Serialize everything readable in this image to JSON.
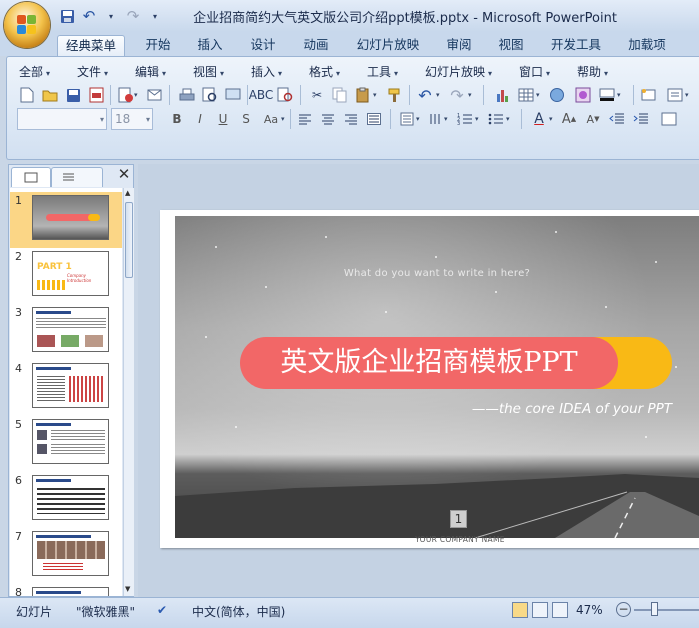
{
  "window": {
    "title": "企业招商简约大气英文版公司介绍ppt模板.pptx - Microsoft PowerPoint"
  },
  "quick_access": {
    "save_icon": "save-icon",
    "undo_icon": "undo-icon",
    "redo_icon": "redo-icon",
    "customize_icon": "chevron-down-icon"
  },
  "tabs": [
    {
      "label": "经典菜单",
      "active": true
    },
    {
      "label": "开始"
    },
    {
      "label": "插入"
    },
    {
      "label": "设计"
    },
    {
      "label": "动画"
    },
    {
      "label": "幻灯片放映"
    },
    {
      "label": "审阅"
    },
    {
      "label": "视图"
    },
    {
      "label": "开发工具"
    },
    {
      "label": "加载项"
    }
  ],
  "menu": [
    {
      "label": "全部"
    },
    {
      "label": "文件"
    },
    {
      "label": "编辑"
    },
    {
      "label": "视图"
    },
    {
      "label": "插入"
    },
    {
      "label": "格式"
    },
    {
      "label": "工具"
    },
    {
      "label": "幻灯片放映"
    },
    {
      "label": "窗口"
    },
    {
      "label": "帮助"
    }
  ],
  "format_toolbar": {
    "font_name": "",
    "font_size": "18"
  },
  "slides": [
    {
      "number": "1"
    },
    {
      "number": "2"
    },
    {
      "number": "3"
    },
    {
      "number": "4"
    },
    {
      "number": "5"
    },
    {
      "number": "6"
    },
    {
      "number": "7"
    },
    {
      "number": "8"
    }
  ],
  "thumbnail_texts": {
    "slide2_title": "PART 1",
    "slide2_subtitle": "Company Introduction"
  },
  "current_slide": {
    "subtitle": "What do you want to write in here?",
    "headline": "英文版企业招商模板PPT",
    "tagline": "——the core IDEA of  your PPT",
    "page_number": "1",
    "company": "YOUR COMPANY NAME",
    "colors": {
      "red": "#f26767",
      "yellow": "#f9b915"
    }
  },
  "statusbar": {
    "view": "幻灯片",
    "theme": "\"微软雅黑\"",
    "language": "中文(简体，中国)",
    "zoom": "47%"
  }
}
